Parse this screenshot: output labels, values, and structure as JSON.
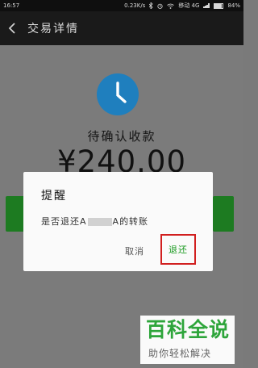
{
  "status_bar": {
    "time": "16:57",
    "speed": "0.23K/s",
    "carrier": "移动 4G",
    "battery": "84%"
  },
  "header": {
    "title": "交易详情",
    "back_icon": "chevron-left-icon"
  },
  "transaction": {
    "status": "待确认收款",
    "amount": "¥240.00",
    "icon": "clock-icon",
    "accent_color": "#1f7fbe"
  },
  "dialog": {
    "title": "提醒",
    "message_prefix": "是否退还",
    "message_name_start": "A",
    "message_name_end": "A",
    "message_suffix": "的转账",
    "cancel_label": "取消",
    "confirm_label": "退还",
    "confirm_color": "#1a9a20",
    "highlight_color": "#d11f1f"
  },
  "watermark": {
    "title": "百科全说",
    "subtitle": "助你轻松解决"
  }
}
